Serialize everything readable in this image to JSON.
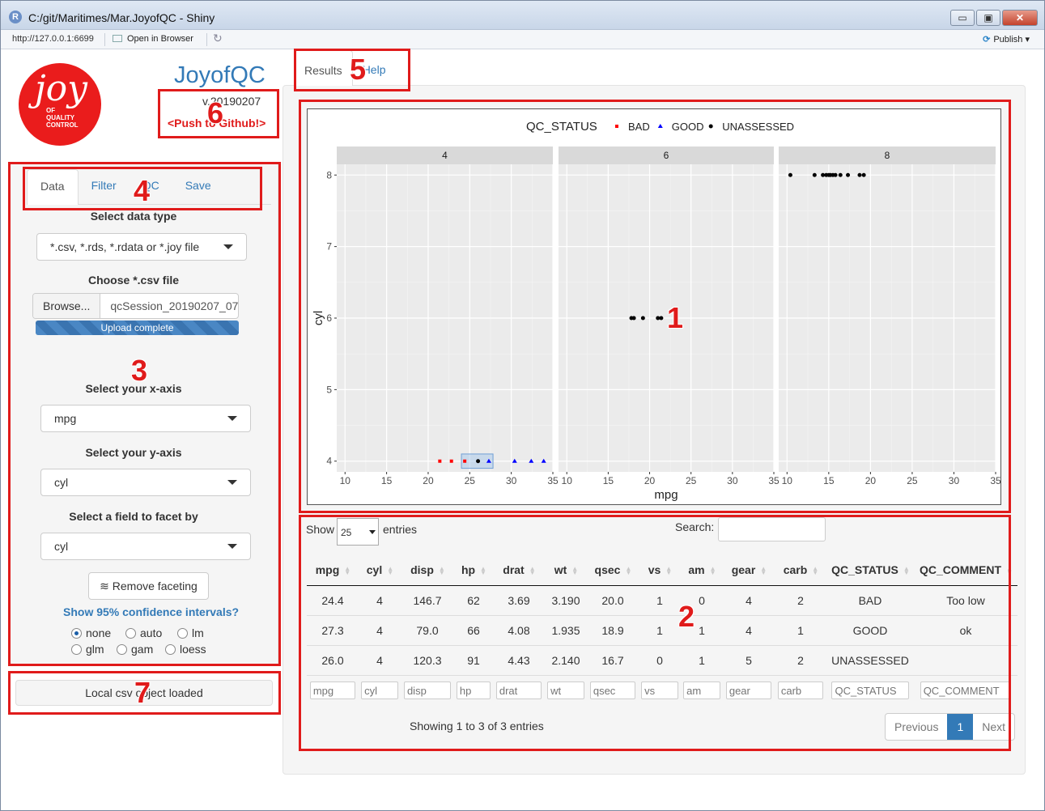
{
  "window": {
    "title": "C:/git/Maritimes/Mar.JoyofQC - Shiny",
    "minimize": "▭",
    "restore": "▣",
    "close": "✕"
  },
  "urlbar": {
    "url": "http://127.0.0.1:6699",
    "open_in_browser": "Open in Browser",
    "publish": "Publish"
  },
  "logo": {
    "letters": "joy",
    "line1": "OF",
    "line2": "QUALITY",
    "line3": "CONTROL"
  },
  "app": {
    "title": "JoyofQC",
    "version": "v.20190207",
    "push_link": "<Push to Github!>"
  },
  "sidebar": {
    "tabs": [
      {
        "label": "Data"
      },
      {
        "label": "Filter"
      },
      {
        "label": "QC"
      },
      {
        "label": "Save"
      }
    ],
    "data_type_label": "Select data type",
    "data_type_value": "*.csv, *.rds, *.rdata or *.joy file",
    "file_label": "Choose *.csv file",
    "browse_label": "Browse...",
    "file_name": "qcSession_20190207_07",
    "progress_text": "Upload complete",
    "progress_fraction": 1.0,
    "x_label": "Select your x-axis",
    "x_value": "mpg",
    "y_label": "Select your y-axis",
    "y_value": "cyl",
    "facet_label": "Select a field to facet by",
    "facet_value": "cyl",
    "remove_facet_label": "Remove faceting",
    "ci_link": "Show 95% confidence intervals?",
    "ci_options": [
      "none",
      "auto",
      "lm",
      "glm",
      "gam",
      "loess"
    ],
    "ci_selected": "none",
    "status_text": "Local csv object loaded"
  },
  "results": {
    "tabs": [
      {
        "label": "Results"
      },
      {
        "label": "Help"
      }
    ]
  },
  "chart_data": {
    "type": "scatter",
    "legend_title": "QC_STATUS",
    "legend_position": "top",
    "legend": [
      {
        "name": "BAD",
        "color": "#ff0000",
        "shape": "square"
      },
      {
        "name": "GOOD",
        "color": "#0000ff",
        "shape": "triangle"
      },
      {
        "name": "UNASSESSED",
        "color": "#000000",
        "shape": "circle"
      }
    ],
    "xlabel": "mpg",
    "ylabel": "cyl",
    "facets": [
      "4",
      "6",
      "8"
    ],
    "xlim": [
      9,
      35
    ],
    "ylim": [
      3.85,
      8.15
    ],
    "x_ticks": [
      10,
      15,
      20,
      25,
      30,
      35
    ],
    "x_tick_labels": [
      "10",
      "15",
      "20",
      "25",
      "30",
      "35"
    ],
    "y_ticks": [
      4,
      5,
      6,
      7,
      8
    ],
    "grid": true,
    "points": [
      {
        "facet": "4",
        "x": 21.4,
        "y": 4,
        "status": "BAD"
      },
      {
        "facet": "4",
        "x": 22.8,
        "y": 4,
        "status": "BAD"
      },
      {
        "facet": "4",
        "x": 24.4,
        "y": 4,
        "status": "BAD"
      },
      {
        "facet": "4",
        "x": 26.0,
        "y": 4,
        "status": "UNASSESSED"
      },
      {
        "facet": "4",
        "x": 27.3,
        "y": 4,
        "status": "GOOD"
      },
      {
        "facet": "4",
        "x": 30.4,
        "y": 4,
        "status": "GOOD"
      },
      {
        "facet": "4",
        "x": 32.4,
        "y": 4,
        "status": "GOOD"
      },
      {
        "facet": "4",
        "x": 33.9,
        "y": 4,
        "status": "GOOD"
      },
      {
        "facet": "6",
        "x": 17.8,
        "y": 6,
        "status": "UNASSESSED"
      },
      {
        "facet": "6",
        "x": 18.1,
        "y": 6,
        "status": "UNASSESSED"
      },
      {
        "facet": "6",
        "x": 19.2,
        "y": 6,
        "status": "UNASSESSED"
      },
      {
        "facet": "6",
        "x": 21.0,
        "y": 6,
        "status": "UNASSESSED"
      },
      {
        "facet": "6",
        "x": 21.4,
        "y": 6,
        "status": "UNASSESSED"
      },
      {
        "facet": "8",
        "x": 10.4,
        "y": 8,
        "status": "UNASSESSED"
      },
      {
        "facet": "8",
        "x": 13.3,
        "y": 8,
        "status": "UNASSESSED"
      },
      {
        "facet": "8",
        "x": 14.3,
        "y": 8,
        "status": "UNASSESSED"
      },
      {
        "facet": "8",
        "x": 14.7,
        "y": 8,
        "status": "UNASSESSED"
      },
      {
        "facet": "8",
        "x": 15.0,
        "y": 8,
        "status": "UNASSESSED"
      },
      {
        "facet": "8",
        "x": 15.2,
        "y": 8,
        "status": "UNASSESSED"
      },
      {
        "facet": "8",
        "x": 15.5,
        "y": 8,
        "status": "UNASSESSED"
      },
      {
        "facet": "8",
        "x": 15.8,
        "y": 8,
        "status": "UNASSESSED"
      },
      {
        "facet": "8",
        "x": 16.4,
        "y": 8,
        "status": "UNASSESSED"
      },
      {
        "facet": "8",
        "x": 17.3,
        "y": 8,
        "status": "UNASSESSED"
      },
      {
        "facet": "8",
        "x": 18.7,
        "y": 8,
        "status": "UNASSESSED"
      },
      {
        "facet": "8",
        "x": 19.2,
        "y": 8,
        "status": "UNASSESSED"
      }
    ],
    "brush": {
      "facet": "4",
      "x": [
        24.0,
        27.8
      ],
      "y": [
        3.9,
        4.1
      ]
    }
  },
  "table": {
    "show_label": "Show",
    "page_length": "25",
    "entries_label": "entries",
    "search_label": "Search:",
    "columns": [
      "mpg",
      "cyl",
      "disp",
      "hp",
      "drat",
      "wt",
      "qsec",
      "vs",
      "am",
      "gear",
      "carb",
      "QC_STATUS",
      "QC_COMMENT"
    ],
    "rows": [
      [
        "24.4",
        "4",
        "146.7",
        "62",
        "3.69",
        "3.190",
        "20.0",
        "1",
        "0",
        "4",
        "2",
        "BAD",
        "Too low"
      ],
      [
        "27.3",
        "4",
        "79.0",
        "66",
        "4.08",
        "1.935",
        "18.9",
        "1",
        "1",
        "4",
        "1",
        "GOOD",
        "ok"
      ],
      [
        "26.0",
        "4",
        "120.3",
        "91",
        "4.43",
        "2.140",
        "16.7",
        "0",
        "1",
        "5",
        "2",
        "UNASSESSED",
        ""
      ]
    ],
    "info": "Showing 1 to 3 of 3 entries",
    "pager": {
      "previous": "Previous",
      "current": "1",
      "next": "Next"
    }
  },
  "annotations": [
    "1",
    "2",
    "3",
    "4",
    "5",
    "6",
    "7"
  ],
  "colors": {
    "annotation": "#e01b1b",
    "link": "#337ab7",
    "logo": "#ea1c1c"
  }
}
